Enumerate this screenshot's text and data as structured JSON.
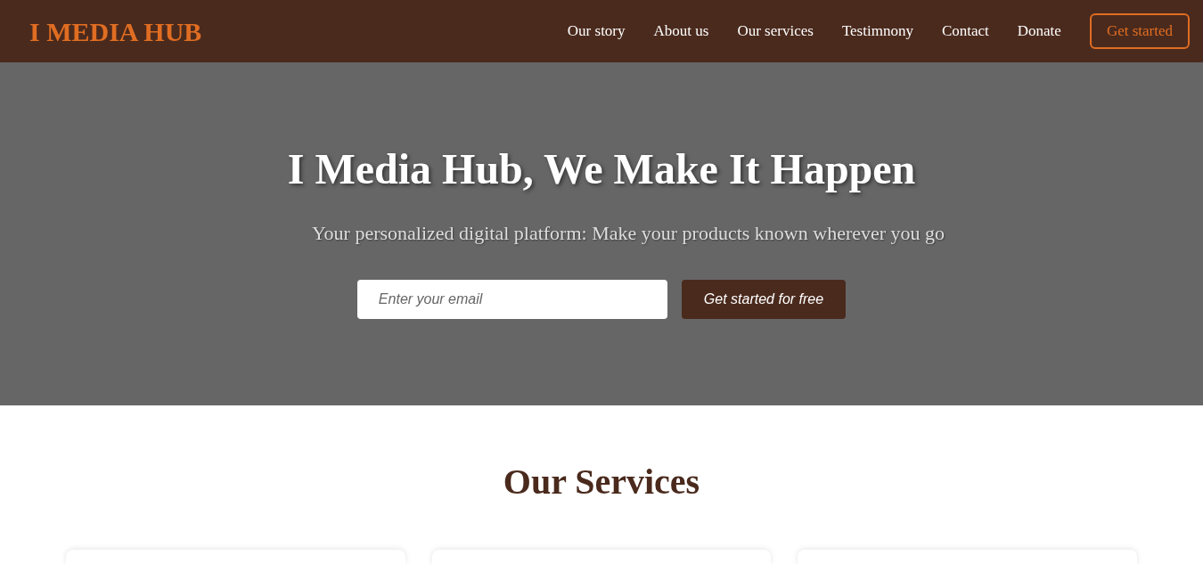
{
  "header": {
    "logo": "I MEDIA HUB",
    "nav": [
      "Our story",
      "About us",
      "Our services",
      "Testimnony",
      "Contact",
      "Donate"
    ],
    "cta": "Get started"
  },
  "hero": {
    "title": "I Media Hub, We Make It Happen",
    "subtitle": "Your personalized digital platform: Make your products known wherever you go",
    "email": {
      "placeholder": "Enter your email"
    },
    "button": "Get started for free"
  },
  "services": {
    "title": "Our Services"
  }
}
